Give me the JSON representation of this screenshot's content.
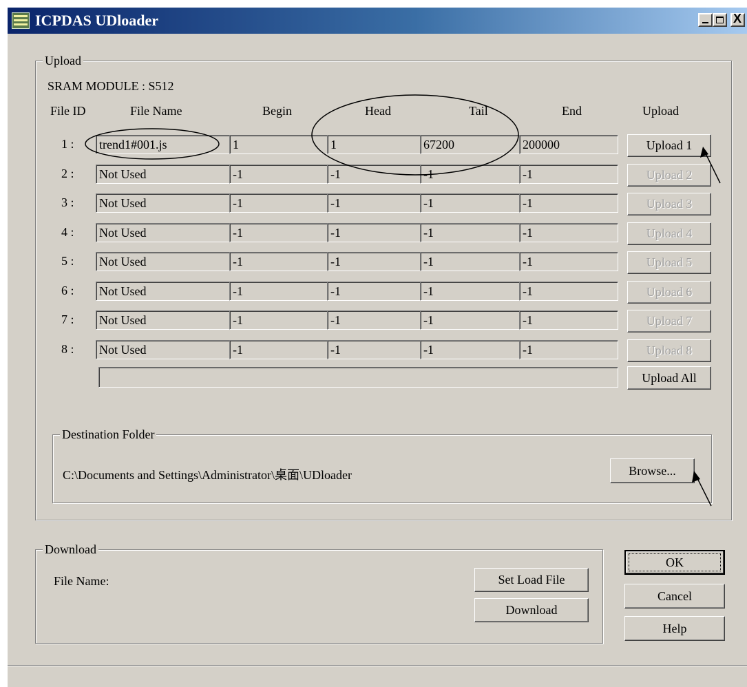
{
  "window": {
    "title": "ICPDAS UDloader",
    "controls": [
      "minimize-icon",
      "maximize-icon",
      "close-icon"
    ],
    "close_glyph": "X"
  },
  "upload": {
    "legend": "Upload",
    "module_label": "SRAM MODULE : S512",
    "headers": {
      "file_id": "File ID",
      "file_name": "File Name",
      "begin": "Begin",
      "head": "Head",
      "tail": "Tail",
      "end": "End",
      "upload": "Upload"
    },
    "rows": [
      {
        "id": "1 :",
        "file_name": "trend1#001.js",
        "begin": "1",
        "head": "1",
        "tail": "67200",
        "end": "200000",
        "button": "Upload 1",
        "enabled": true
      },
      {
        "id": "2 :",
        "file_name": "Not Used",
        "begin": "-1",
        "head": "-1",
        "tail": "-1",
        "end": "-1",
        "button": "Upload 2",
        "enabled": false
      },
      {
        "id": "3 :",
        "file_name": "Not Used",
        "begin": "-1",
        "head": "-1",
        "tail": "-1",
        "end": "-1",
        "button": "Upload 3",
        "enabled": false
      },
      {
        "id": "4 :",
        "file_name": "Not Used",
        "begin": "-1",
        "head": "-1",
        "tail": "-1",
        "end": "-1",
        "button": "Upload 4",
        "enabled": false
      },
      {
        "id": "5 :",
        "file_name": "Not Used",
        "begin": "-1",
        "head": "-1",
        "tail": "-1",
        "end": "-1",
        "button": "Upload 5",
        "enabled": false
      },
      {
        "id": "6 :",
        "file_name": "Not Used",
        "begin": "-1",
        "head": "-1",
        "tail": "-1",
        "end": "-1",
        "button": "Upload 6",
        "enabled": false
      },
      {
        "id": "7 :",
        "file_name": "Not Used",
        "begin": "-1",
        "head": "-1",
        "tail": "-1",
        "end": "-1",
        "button": "Upload 7",
        "enabled": false
      },
      {
        "id": "8 :",
        "file_name": "Not Used",
        "begin": "-1",
        "head": "-1",
        "tail": "-1",
        "end": "-1",
        "button": "Upload 8",
        "enabled": false
      }
    ],
    "progress": 0,
    "upload_all_label": "Upload All"
  },
  "destination": {
    "legend": "Destination Folder",
    "path": "C:\\Documents and Settings\\Administrator\\桌面\\UDloader",
    "browse_label": "Browse..."
  },
  "download": {
    "legend": "Download",
    "file_name_label": "File Name:",
    "set_load_file_label": "Set Load File",
    "download_label": "Download"
  },
  "dialog": {
    "ok_label": "OK",
    "cancel_label": "Cancel",
    "help_label": "Help"
  },
  "status_text": ""
}
